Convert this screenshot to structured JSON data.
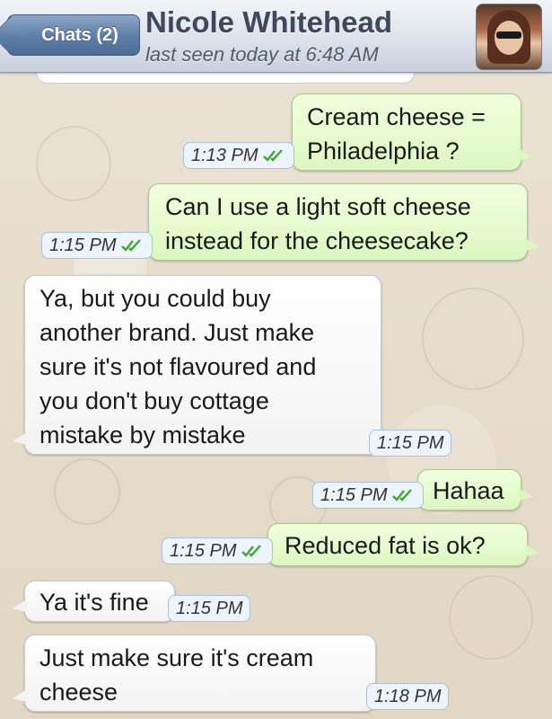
{
  "header": {
    "back_label": "Chats (2)",
    "contact_name": "Nicole Whitehead",
    "last_seen": "last seen today at 6:48 AM"
  },
  "messages": [
    {
      "direction": "out",
      "lines": [
        "Cream cheese =",
        "Philadelphia ?"
      ],
      "time": "1:13 PM",
      "status": "read"
    },
    {
      "direction": "out",
      "lines": [
        "Can I use a light soft cheese",
        "instead for the cheesecake?"
      ],
      "time": "1:15 PM",
      "status": "read"
    },
    {
      "direction": "in",
      "lines": [
        "Ya, but you could buy",
        "another brand. Just make",
        "sure it's not flavoured and",
        "you don't buy cottage",
        "mistake by mistake"
      ],
      "time": "1:15 PM"
    },
    {
      "direction": "out",
      "lines": [
        "Hahaa"
      ],
      "time": "1:15 PM",
      "status": "read"
    },
    {
      "direction": "out",
      "lines": [
        "Reduced fat is ok?"
      ],
      "time": "1:15 PM",
      "status": "read"
    },
    {
      "direction": "in",
      "lines": [
        "Ya it's fine"
      ],
      "time": "1:15 PM"
    },
    {
      "direction": "in",
      "lines": [
        "Just make sure it's cream",
        "cheese"
      ],
      "time": "1:18 PM"
    }
  ],
  "colors": {
    "outgoing_bubble": "#dcf7c0",
    "incoming_bubble": "#ffffff",
    "read_check": "#3aa82c",
    "header_bg": "#dfe4ec"
  },
  "icons": {
    "read_status": "double-check-icon"
  }
}
